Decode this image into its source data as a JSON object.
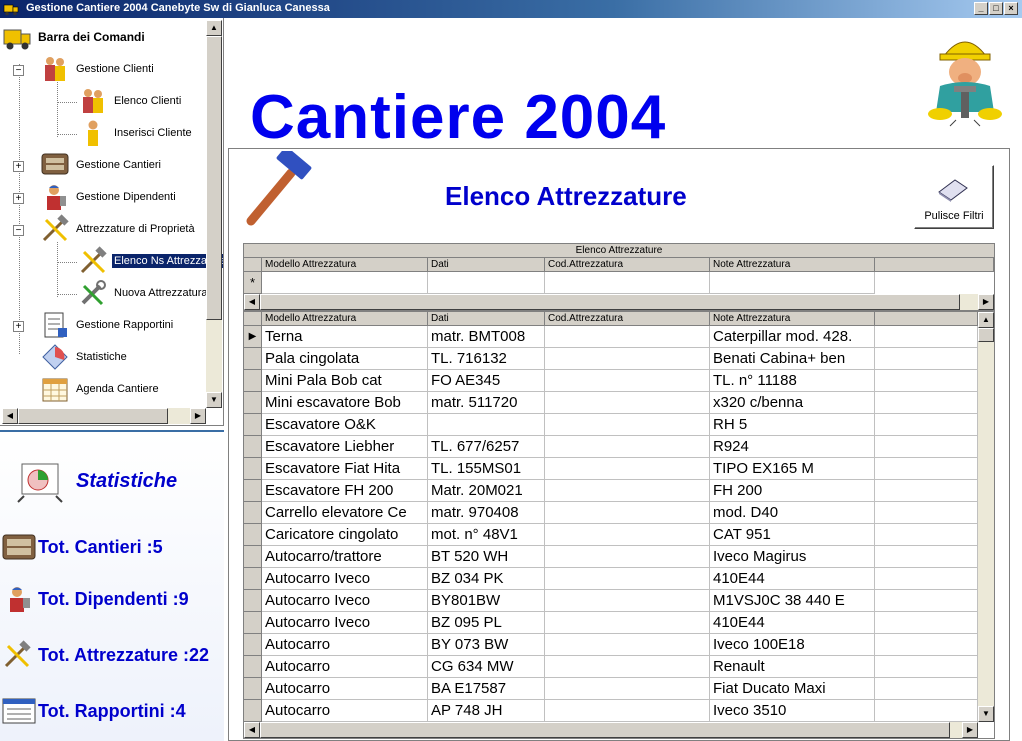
{
  "window": {
    "title": "Gestione Cantiere 2004   Canebyte Sw di Gianluca Canessa",
    "buttons": {
      "minimize": "_",
      "maximize": "□",
      "close": "×"
    }
  },
  "tree": {
    "root": "Barra dei Comandi",
    "items": [
      {
        "label": "Gestione Clienti",
        "icon": "people-icon",
        "expander": "−"
      },
      {
        "label": "Elenco Clienti",
        "icon": "people-icon"
      },
      {
        "label": "Inserisci Cliente",
        "icon": "person-icon"
      },
      {
        "label": "Gestione Cantieri",
        "icon": "sign-icon",
        "expander": "+"
      },
      {
        "label": "Gestione Dipendenti",
        "icon": "worker-icon",
        "expander": "+"
      },
      {
        "label": "Attrezzature di Proprietà",
        "icon": "tools-icon",
        "expander": "−"
      },
      {
        "label": "Elenco Ns Attrezzature",
        "icon": "tools-icon",
        "selected": true
      },
      {
        "label": "Nuova Attrezzatura",
        "icon": "wrench-icon"
      },
      {
        "label": "Gestione Rapportini",
        "icon": "report-icon",
        "expander": "+"
      },
      {
        "label": "Statistiche",
        "icon": "stats-icon"
      },
      {
        "label": "Agenda Cantiere",
        "icon": "calendar-icon"
      }
    ]
  },
  "stats": {
    "title": "Statistiche",
    "rows": [
      {
        "label": "Tot. Cantieri :5",
        "icon": "sign-icon"
      },
      {
        "label": "Tot. Dipendenti :9",
        "icon": "worker-icon"
      },
      {
        "label": "Tot. Attrezzature :22",
        "icon": "tools-icon"
      },
      {
        "label": "Tot. Rapportini :4",
        "icon": "report-icon"
      }
    ]
  },
  "main": {
    "app_title": "Cantiere 2004",
    "form_title": "Elenco Attrezzature",
    "clear_filters_label": "Pulisce Filtri"
  },
  "grid": {
    "caption": "Elenco Attrezzature",
    "columns": [
      "Modello Attrezzatura",
      "Dati",
      "Cod.Attrezzatura",
      "Note Attrezzatura"
    ],
    "new_row_marker": "*",
    "current_row_marker": "▶",
    "rows": [
      [
        "Terna",
        "matr. BMT008",
        "",
        "Caterpillar mod. 428."
      ],
      [
        "Pala cingolata",
        "TL. 716132",
        "",
        " Benati Cabina+ ben"
      ],
      [
        "Mini Pala Bob cat",
        "FO AE345",
        "",
        "TL. n° 11188"
      ],
      [
        "Mini escavatore Bob",
        "matr. 511720",
        "",
        "x320 c/benna"
      ],
      [
        "Escavatore O&K",
        "",
        "",
        "RH 5"
      ],
      [
        "Escavatore Liebher",
        "TL. 677/6257",
        "",
        "R924"
      ],
      [
        "Escavatore Fiat Hita",
        "TL. 155MS01",
        "",
        "TIPO EX165 M"
      ],
      [
        "Escavatore FH 200",
        "Matr. 20M021",
        "",
        "FH 200"
      ],
      [
        "Carrello elevatore Ce",
        "matr. 970408",
        "",
        "mod. D40"
      ],
      [
        "Caricatore cingolato",
        "mot. n° 48V1",
        "",
        "CAT 951"
      ],
      [
        "Autocarro/trattore",
        "BT 520 WH",
        "",
        "Iveco Magirus"
      ],
      [
        "Autocarro Iveco",
        "BZ 034 PK",
        "",
        "410E44"
      ],
      [
        "Autocarro Iveco",
        "BY801BW",
        "",
        "M1VSJ0C 38 440 E"
      ],
      [
        "Autocarro Iveco",
        "BZ 095 PL",
        "",
        "410E44"
      ],
      [
        "Autocarro",
        "BY 073 BW",
        "",
        "Iveco 100E18"
      ],
      [
        "Autocarro",
        "CG 634 MW",
        "",
        " Renault"
      ],
      [
        "Autocarro",
        "BA E17587",
        "",
        " Fiat Ducato Maxi"
      ],
      [
        "Autocarro",
        "AP 748 JH",
        "",
        "  Iveco 3510"
      ]
    ]
  }
}
